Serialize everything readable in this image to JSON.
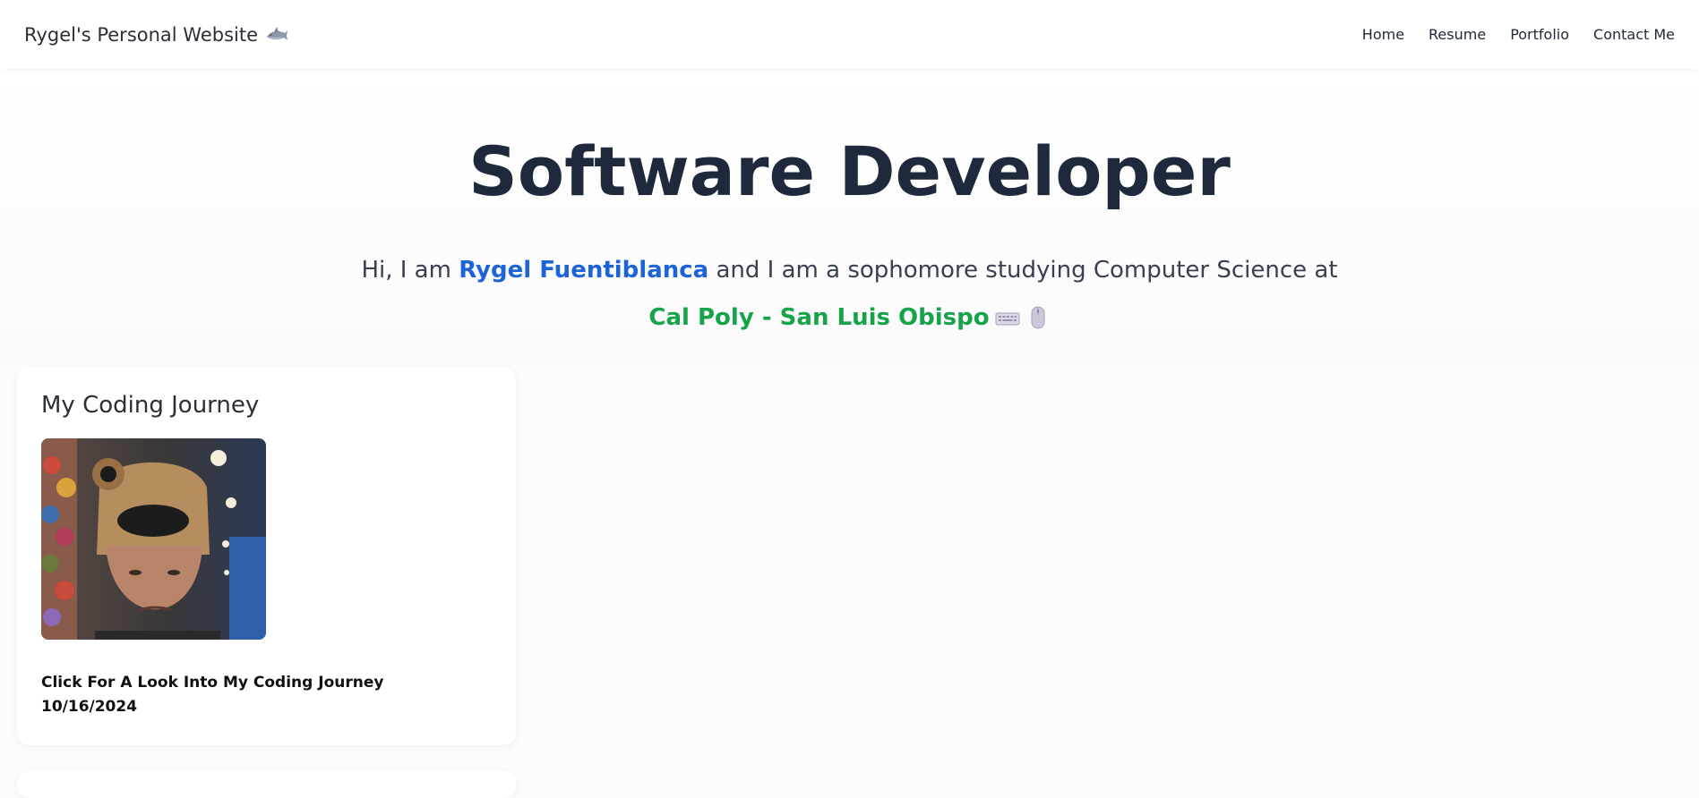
{
  "nav": {
    "brand": "Rygel's Personal Website",
    "brand_icon": "shark-icon",
    "links": [
      {
        "label": "Home"
      },
      {
        "label": "Resume"
      },
      {
        "label": "Portfolio"
      },
      {
        "label": "Contact Me"
      }
    ]
  },
  "hero": {
    "title": "Software Developer",
    "intro_prefix": "Hi, I am ",
    "name": "Rygel Fuentiblanca",
    "intro_suffix": " and I am a sophomore studying Computer Science at",
    "school": "Cal Poly - San Luis Obispo",
    "school_icons": [
      "keyboard-icon",
      "mouse-icon"
    ]
  },
  "cards": [
    {
      "title": "My Coding Journey",
      "image_icon": "profile-photo",
      "link_label": "Click For A Look Into My Coding Journey",
      "date": "10/16/2024"
    }
  ],
  "colors": {
    "name_blue": "#1d64d8",
    "school_green": "#16a34a",
    "title_dark": "#1e293b"
  }
}
